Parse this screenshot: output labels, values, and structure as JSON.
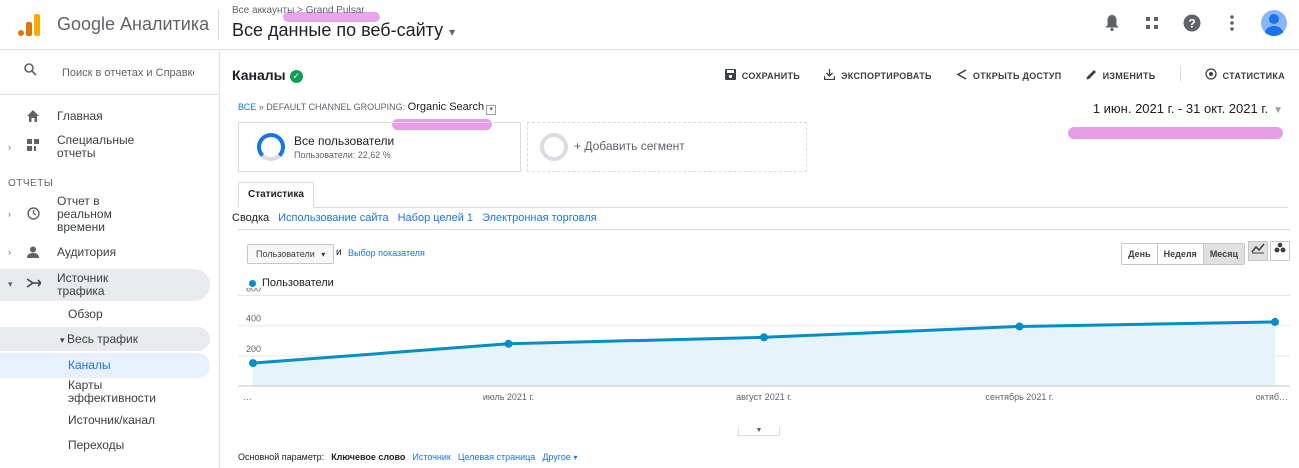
{
  "app": {
    "brand": "Google Аналитика",
    "breadcrumb_prefix": "Все аккаунты",
    "breadcrumb_sep": ">",
    "property": "Grand Pulsar",
    "view": "Все данные по веб-сайту"
  },
  "sidebar": {
    "search_placeholder": "Поиск в отчетах и Справке",
    "section_reports": "ОТЧЕТЫ",
    "items": {
      "home": "Главная",
      "custom_reports": "Специальные отчеты",
      "realtime": "Отчет в реальном времени",
      "audience": "Аудитория",
      "acquisition": "Источник трафика",
      "overview": "Обзор",
      "all_traffic": "Весь трафик",
      "channels": "Каналы",
      "treemaps": "Карты эффективности",
      "source_medium": "Источник/канал",
      "referrals": "Переходы"
    }
  },
  "report": {
    "title": "Каналы",
    "actions": {
      "save": "СОХРАНИТЬ",
      "export": "ЭКСПОРТИРОВАТЬ",
      "share": "ОТКРЫТЬ ДОСТУП",
      "edit": "ИЗМЕНИТЬ",
      "insights": "СТАТИСТИКА"
    },
    "crumb_all": "ВСЕ",
    "crumb_sep": "»",
    "crumb_grouping": "DEFAULT CHANNEL GROUPING:",
    "crumb_value": "Organic Search",
    "date_range": "1 июн. 2021 г. - 31 окт. 2021 г.",
    "segment_name": "Все пользователи",
    "segment_sub": "Пользователи: 22,62 %",
    "add_segment": "+ Добавить сегмент",
    "tab": "Статистика",
    "subtabs": [
      "Сводка",
      "Использование сайта",
      "Набор целей 1",
      "Электронная торговля"
    ],
    "metric": "Пользователи",
    "and": "и",
    "metric_pick": "Выбор показателя",
    "periods": [
      "День",
      "Неделя",
      "Месяц"
    ],
    "legend": "Пользователи",
    "primary_dimension": "Основной параметр:",
    "dim_keyword": "Ключевое слово",
    "dim_source": "Источник",
    "dim_landing": "Целевая страница",
    "dim_other": "Другое"
  },
  "chart_data": {
    "type": "area",
    "x": [
      "…",
      "июль 2021 г.",
      "август 2021 г.",
      "сентябрь 2021 г.",
      "октяб…"
    ],
    "series": [
      {
        "name": "Пользователи",
        "values": [
          152,
          280,
          323,
          395,
          425
        ]
      }
    ],
    "y_ticks": [
      200,
      400,
      600
    ],
    "ylim": [
      0,
      650
    ],
    "color": "#058dc7"
  },
  "colors": {
    "accent": "#1a73e8",
    "line": "#058dc7",
    "highlight": "#d65cd6"
  }
}
